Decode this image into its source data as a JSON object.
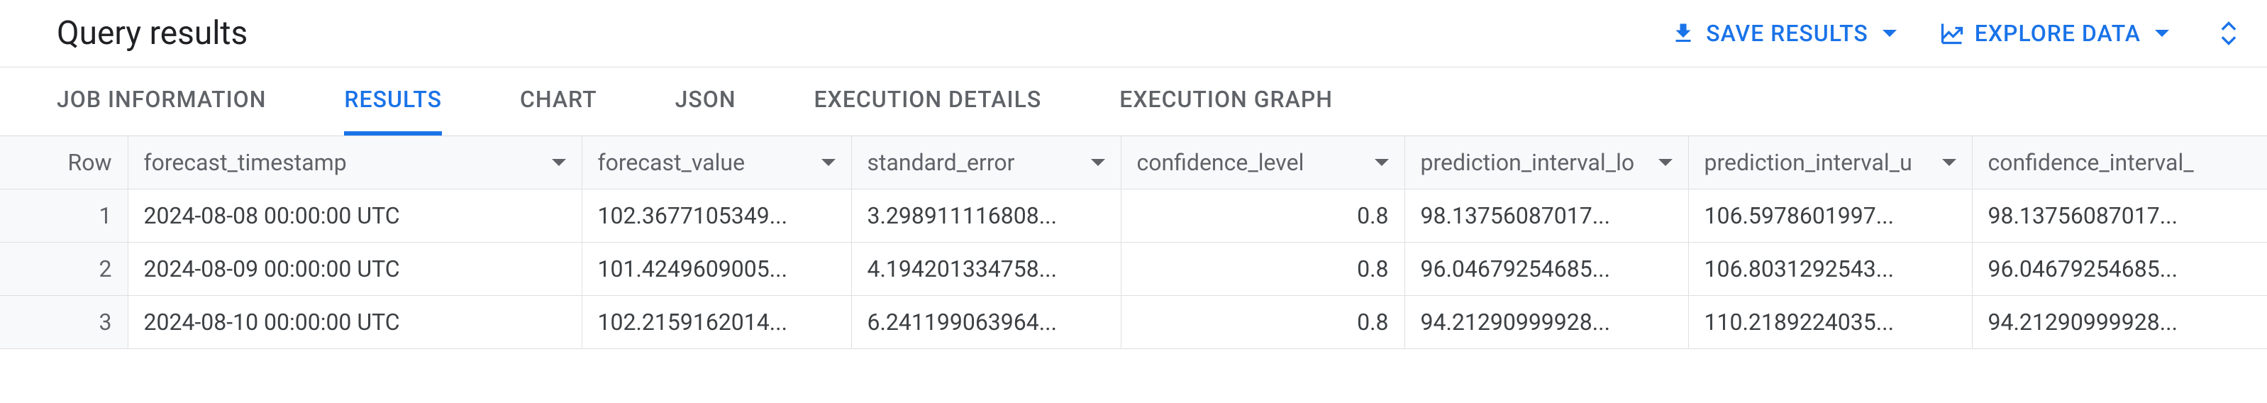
{
  "header": {
    "title": "Query results",
    "save_label": "SAVE RESULTS",
    "explore_label": "EXPLORE DATA"
  },
  "tabs": {
    "job_info": "JOB INFORMATION",
    "results": "RESULTS",
    "chart": "CHART",
    "json": "JSON",
    "exec_details": "EXECUTION DETAILS",
    "exec_graph": "EXECUTION GRAPH"
  },
  "columns": {
    "row": "Row",
    "forecast_timestamp": "forecast_timestamp",
    "forecast_value": "forecast_value",
    "standard_error": "standard_error",
    "confidence_level": "confidence_level",
    "prediction_interval_lower": "prediction_interval_lo",
    "prediction_interval_upper": "prediction_interval_u",
    "confidence_interval_lower": "confidence_interval_"
  },
  "rows": [
    {
      "n": "1",
      "forecast_timestamp": "2024-08-08 00:00:00 UTC",
      "forecast_value": "102.3677105349...",
      "standard_error": "3.298911116808...",
      "confidence_level": "0.8",
      "prediction_interval_lower": "98.13756087017...",
      "prediction_interval_upper": "106.5978601997...",
      "confidence_interval_lower": "98.13756087017..."
    },
    {
      "n": "2",
      "forecast_timestamp": "2024-08-09 00:00:00 UTC",
      "forecast_value": "101.4249609005...",
      "standard_error": "4.194201334758...",
      "confidence_level": "0.8",
      "prediction_interval_lower": "96.04679254685...",
      "prediction_interval_upper": "106.8031292543...",
      "confidence_interval_lower": "96.04679254685..."
    },
    {
      "n": "3",
      "forecast_timestamp": "2024-08-10 00:00:00 UTC",
      "forecast_value": "102.2159162014...",
      "standard_error": "6.241199063964...",
      "confidence_level": "0.8",
      "prediction_interval_lower": "94.21290999928...",
      "prediction_interval_upper": "110.2189224035...",
      "confidence_interval_lower": "94.21290999928..."
    }
  ]
}
